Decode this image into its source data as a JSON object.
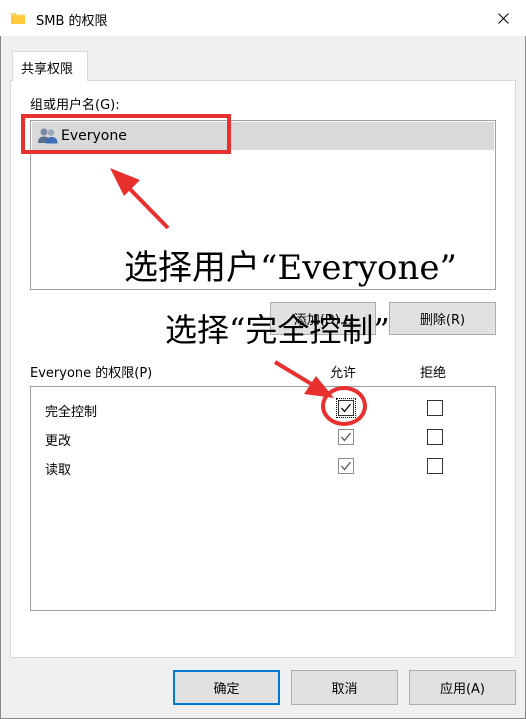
{
  "window": {
    "title": "SMB 的权限",
    "close_label": "Close"
  },
  "tabs": [
    {
      "label": "共享权限"
    }
  ],
  "group": {
    "label": "组或用户名(G):",
    "users": [
      {
        "name": "Everyone",
        "icon": "users-icon"
      }
    ]
  },
  "buttons": {
    "add": "添加(D)...",
    "remove": "删除(R)"
  },
  "permissions": {
    "title": "Everyone 的权限(P)",
    "allow_header": "允许",
    "deny_header": "拒绝",
    "rows": [
      {
        "name": "完全控制",
        "allow": true,
        "deny": false
      },
      {
        "name": "更改",
        "allow": true,
        "deny": false
      },
      {
        "name": "读取",
        "allow": true,
        "deny": false
      }
    ]
  },
  "footer": {
    "ok": "确定",
    "cancel": "取消",
    "apply": "应用(A)"
  },
  "annotations": {
    "select_user": "选择用户“Everyone”",
    "select_full_control": "选择“完全控制”",
    "color": "#e8302f"
  }
}
